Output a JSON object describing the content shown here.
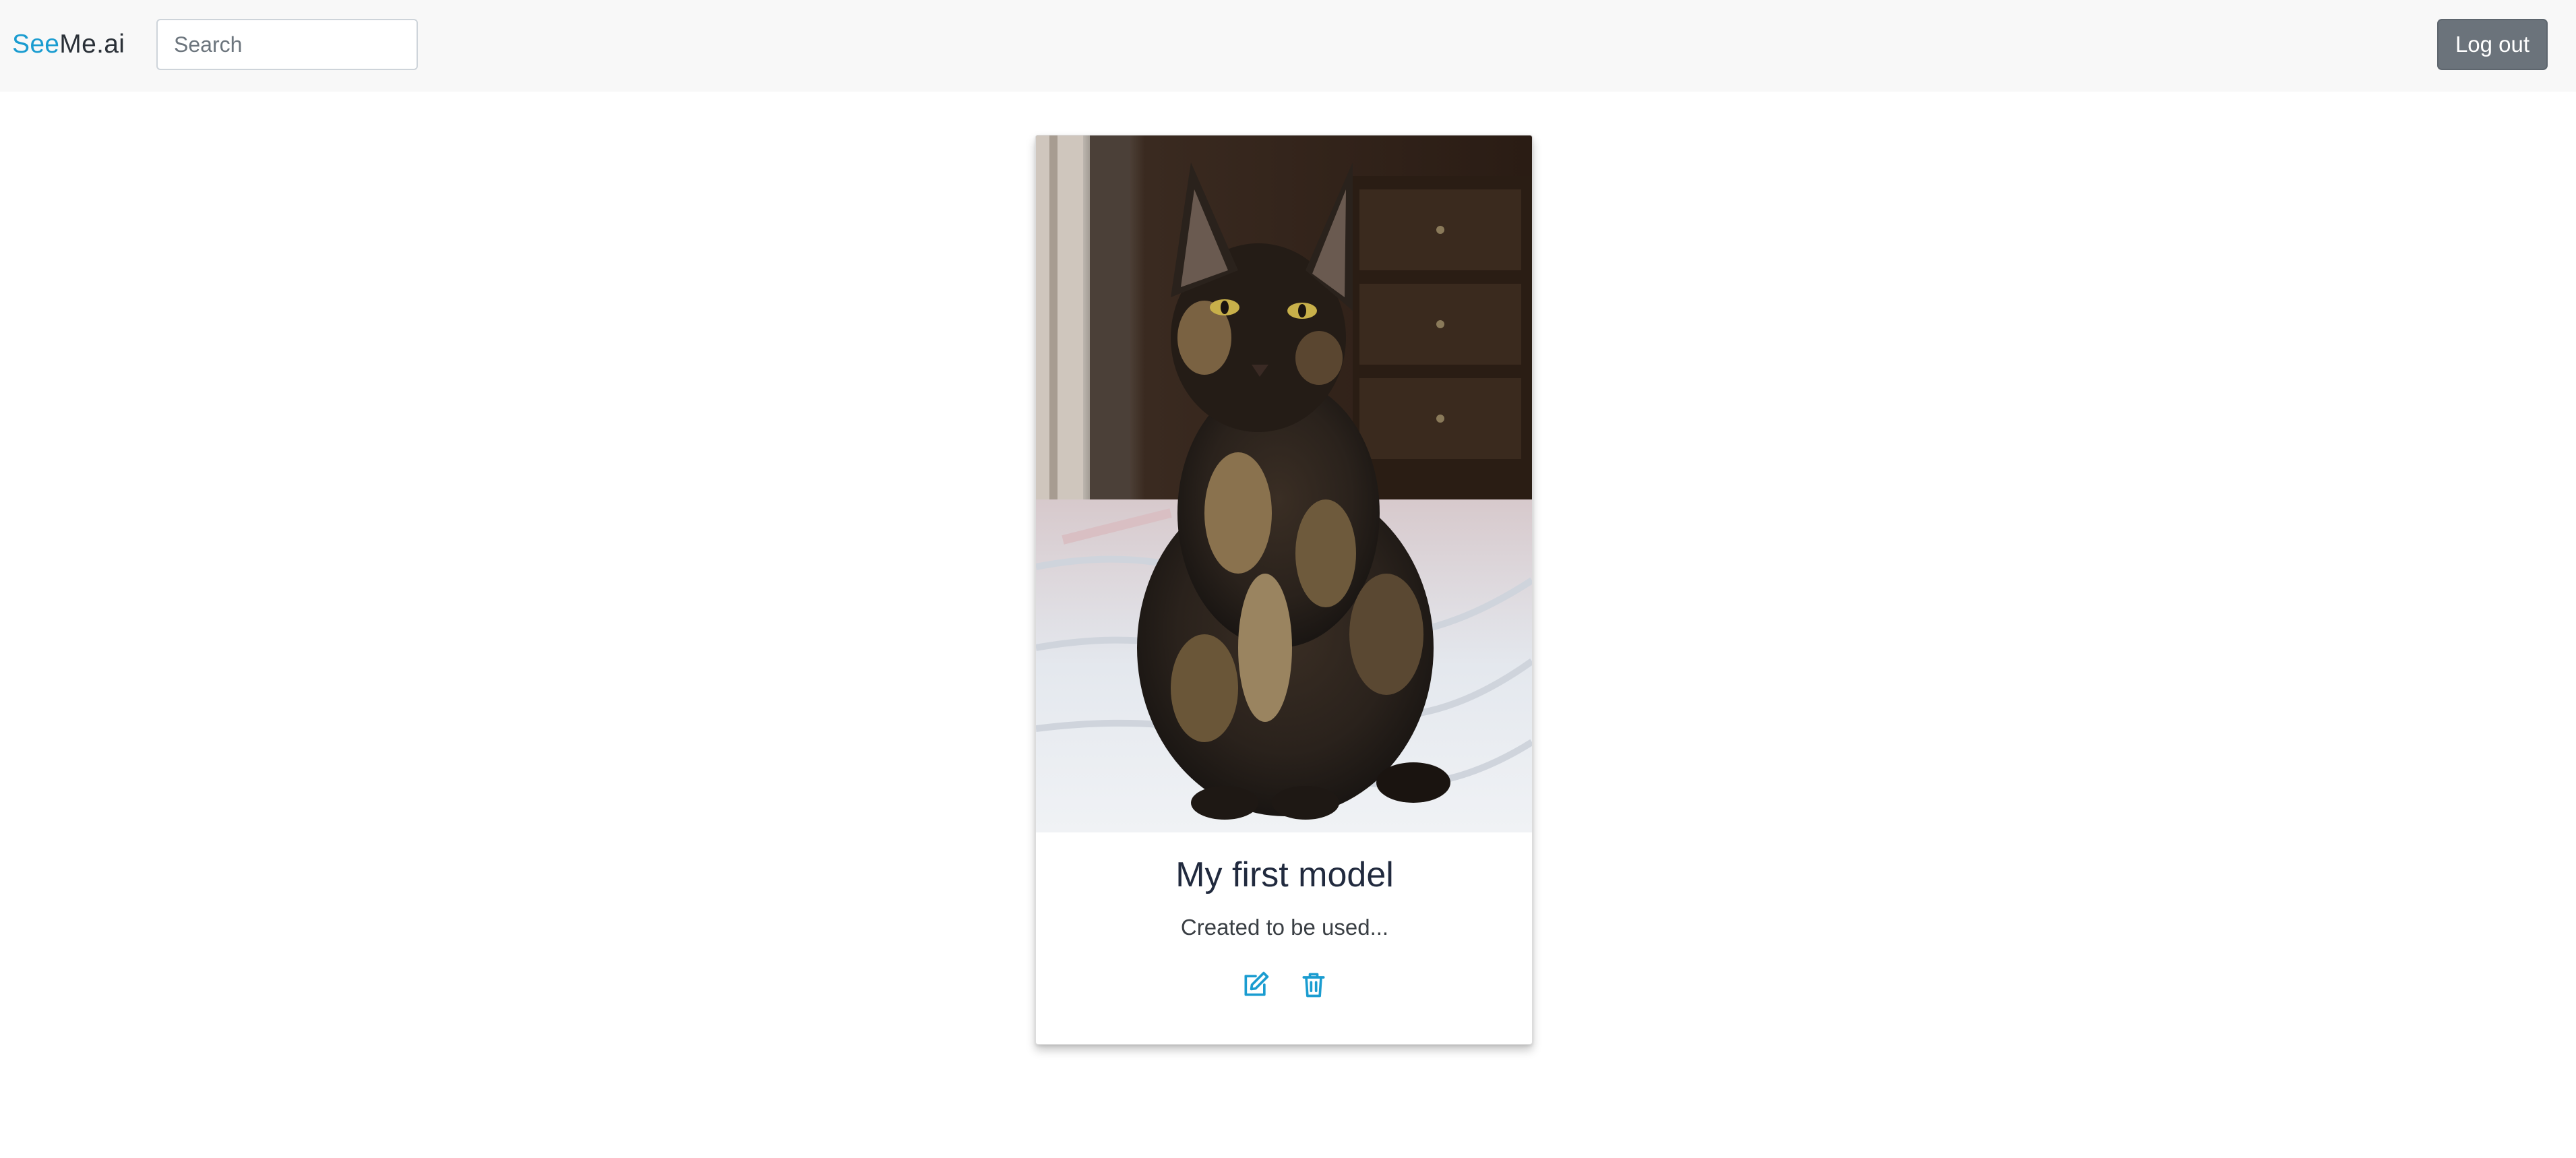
{
  "navbar": {
    "brand_part1": "See",
    "brand_part2": "Me.ai",
    "search_placeholder": "Search",
    "search_value": "",
    "logout_label": "Log out"
  },
  "card": {
    "title": "My first model",
    "description": "Created to be used...",
    "image_subject": "tortoiseshell cat sitting on a bed",
    "edit_icon": "edit-icon",
    "delete_icon": "trash-icon",
    "accent_color": "#1a9cd0"
  },
  "colors": {
    "brand_accent": "#1a9cd0",
    "navbar_bg": "#f8f8f8",
    "logout_bg": "#6b737b",
    "title_text": "#212a3e"
  }
}
